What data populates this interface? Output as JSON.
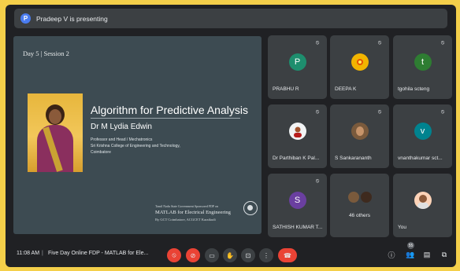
{
  "presenting": {
    "initial": "P",
    "text": "Pradeep V is presenting"
  },
  "slide": {
    "session": "Day 5 | Session 2",
    "title": "Algorithm for Predictive Analysis",
    "speaker": "Dr M Lydia Edwin",
    "role": "Professor and Head / Mechatronics",
    "college": "Sri Krishna College of Engineering and Technology,",
    "city": "Coimbatore",
    "sponsor": "Tamil Nadu State Government Sponsored FDP on",
    "program": "MATLAB for Electrical Engineering",
    "by": "By GCT Coimbatore, ACGCET Karaikudi"
  },
  "participants": [
    {
      "name": "PRABHU R",
      "initial": "P",
      "color": "#1e8e6e"
    },
    {
      "name": "DEEPA K",
      "initial": "",
      "color": "#f2b400"
    },
    {
      "name": "tgohila scteng",
      "initial": "t",
      "color": "#2e7d32"
    },
    {
      "name": "Dr Parthiban K Pal...",
      "initial": "",
      "color": "#f1f3f4"
    },
    {
      "name": "S Sankarananth",
      "initial": "",
      "color": "#5d4037"
    },
    {
      "name": "vnanthakumar sct...",
      "initial": "v",
      "color": "#00838f"
    },
    {
      "name": "SATHISH KUMAR T...",
      "initial": "S",
      "color": "#6a3fa0"
    },
    {
      "name": "46 others",
      "initial": "",
      "color": "#5d4037"
    },
    {
      "name": "You",
      "initial": "",
      "color": "#fdd3b8"
    }
  ],
  "bottom": {
    "time": "11:08 AM",
    "separator": "|",
    "meeting": "Five Day Online FDP - MATLAB for Ele...",
    "people_count": "55"
  },
  "icons": {
    "mic_off": "mic-off-icon",
    "cam_off": "camera-off-icon",
    "captions": "cc-icon",
    "hand": "raise-hand-icon",
    "present": "present-icon",
    "more": "more-icon",
    "end": "end-call-icon"
  }
}
